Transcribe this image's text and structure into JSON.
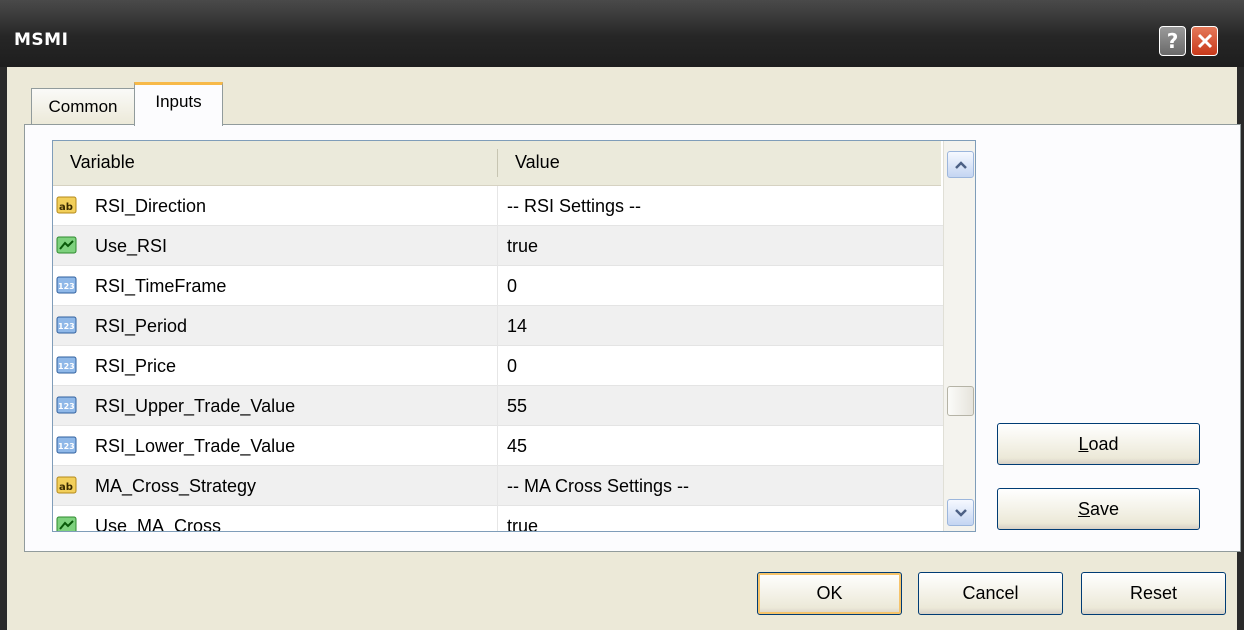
{
  "window": {
    "title": "MSMI"
  },
  "tabs": [
    {
      "label": "Common"
    },
    {
      "label": "Inputs"
    }
  ],
  "grid": {
    "headers": {
      "variable": "Variable",
      "value": "Value"
    },
    "rows": [
      {
        "icon": "string-type-icon",
        "variable": "RSI_Direction",
        "value": "-- RSI Settings --"
      },
      {
        "icon": "bool-type-icon",
        "variable": "Use_RSI",
        "value": "true"
      },
      {
        "icon": "int-type-icon",
        "variable": "RSI_TimeFrame",
        "value": "0"
      },
      {
        "icon": "int-type-icon",
        "variable": "RSI_Period",
        "value": "14"
      },
      {
        "icon": "int-type-icon",
        "variable": "RSI_Price",
        "value": "0"
      },
      {
        "icon": "int-type-icon",
        "variable": "RSI_Upper_Trade_Value",
        "value": "55"
      },
      {
        "icon": "int-type-icon",
        "variable": "RSI_Lower_Trade_Value",
        "value": "45"
      },
      {
        "icon": "string-type-icon",
        "variable": "MA_Cross_Strategy",
        "value": "-- MA Cross Settings --"
      },
      {
        "icon": "bool-type-icon",
        "variable": "Use_MA_Cross",
        "value": "true"
      }
    ]
  },
  "buttons": {
    "load": {
      "mnemonic": "L",
      "rest": "oad"
    },
    "save": {
      "mnemonic": "S",
      "rest": "ave"
    },
    "ok": "OK",
    "cancel": "Cancel",
    "reset": "Reset"
  },
  "colors": {
    "titlebar": "#2b2b2b",
    "dialog_bg": "#ece9d8",
    "close": "#d4502b",
    "tab_highlight": "#f7b949"
  }
}
